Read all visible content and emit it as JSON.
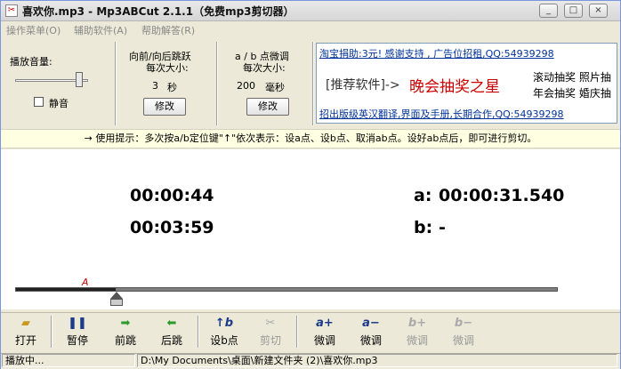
{
  "window": {
    "title": "喜欢你.mp3 - Mp3ABCut 2.1.1（免费mp3剪切器）",
    "buttons": {
      "minimize": "_",
      "maximize": "□",
      "close": "×"
    }
  },
  "menu": {
    "items": [
      "操作菜单(O)",
      "辅助软件(A)",
      "帮助解答(R)"
    ]
  },
  "volume": {
    "label": "播放音量:",
    "level": 0.85,
    "mute_label": "静音",
    "mute_checked": false
  },
  "jump": {
    "title_line1": "向前/向后跳跃",
    "title_line2": "每次大小:",
    "value": "3",
    "unit": "秒",
    "button": "修改"
  },
  "fine": {
    "title_line1": "a / b 点微调",
    "title_line2": "每次大小:",
    "value": "200",
    "unit": "毫秒",
    "button": "修改"
  },
  "ads": {
    "line1": "淘宝捐助:3元! 感谢支持 , 广告位招租,QQ:54939298",
    "line2_bracket": "[推荐软件]->",
    "line2_red": "晚会抽奖之星",
    "line2_right_a": "滚动抽奖 照片抽",
    "line2_right_b": "年会抽奖 婚庆抽",
    "line3": "招出版级英汉翻译,界面及手册,长期合作,QQ:54939298"
  },
  "hint": "→ 使用提示：多次按a/b定位键\"↑\"依次表示：设a点、设b点、取消ab点。设好ab点后，即可进行剪切。",
  "times": {
    "current": "00:00:44",
    "total": "00:03:59",
    "a_label": "a:",
    "a_value": "00:00:31.540",
    "b_label": "b:",
    "b_value": "-"
  },
  "seek": {
    "progress": 0.184,
    "marker_a": "A"
  },
  "toolbar": {
    "open": "打开",
    "pause": "暂停",
    "forward": "前跳",
    "back": "后跳",
    "set_b": "设b点",
    "cut": "剪切",
    "a_plus": "微调",
    "a_minus": "微调",
    "b_plus": "微调",
    "b_minus": "微调",
    "icons": {
      "a_plus": "a+",
      "a_minus": "a−",
      "b_plus": "b+",
      "b_minus": "b−",
      "set_b": "↑b"
    }
  },
  "status": {
    "state": "播放中...",
    "path": "D:\\My Documents\\桌面\\新建文件夹 (2)\\喜欢你.mp3"
  },
  "colors": {
    "accent_red": "#cc0000",
    "link_blue": "#003399",
    "hint_bg": "#ffffe1"
  }
}
